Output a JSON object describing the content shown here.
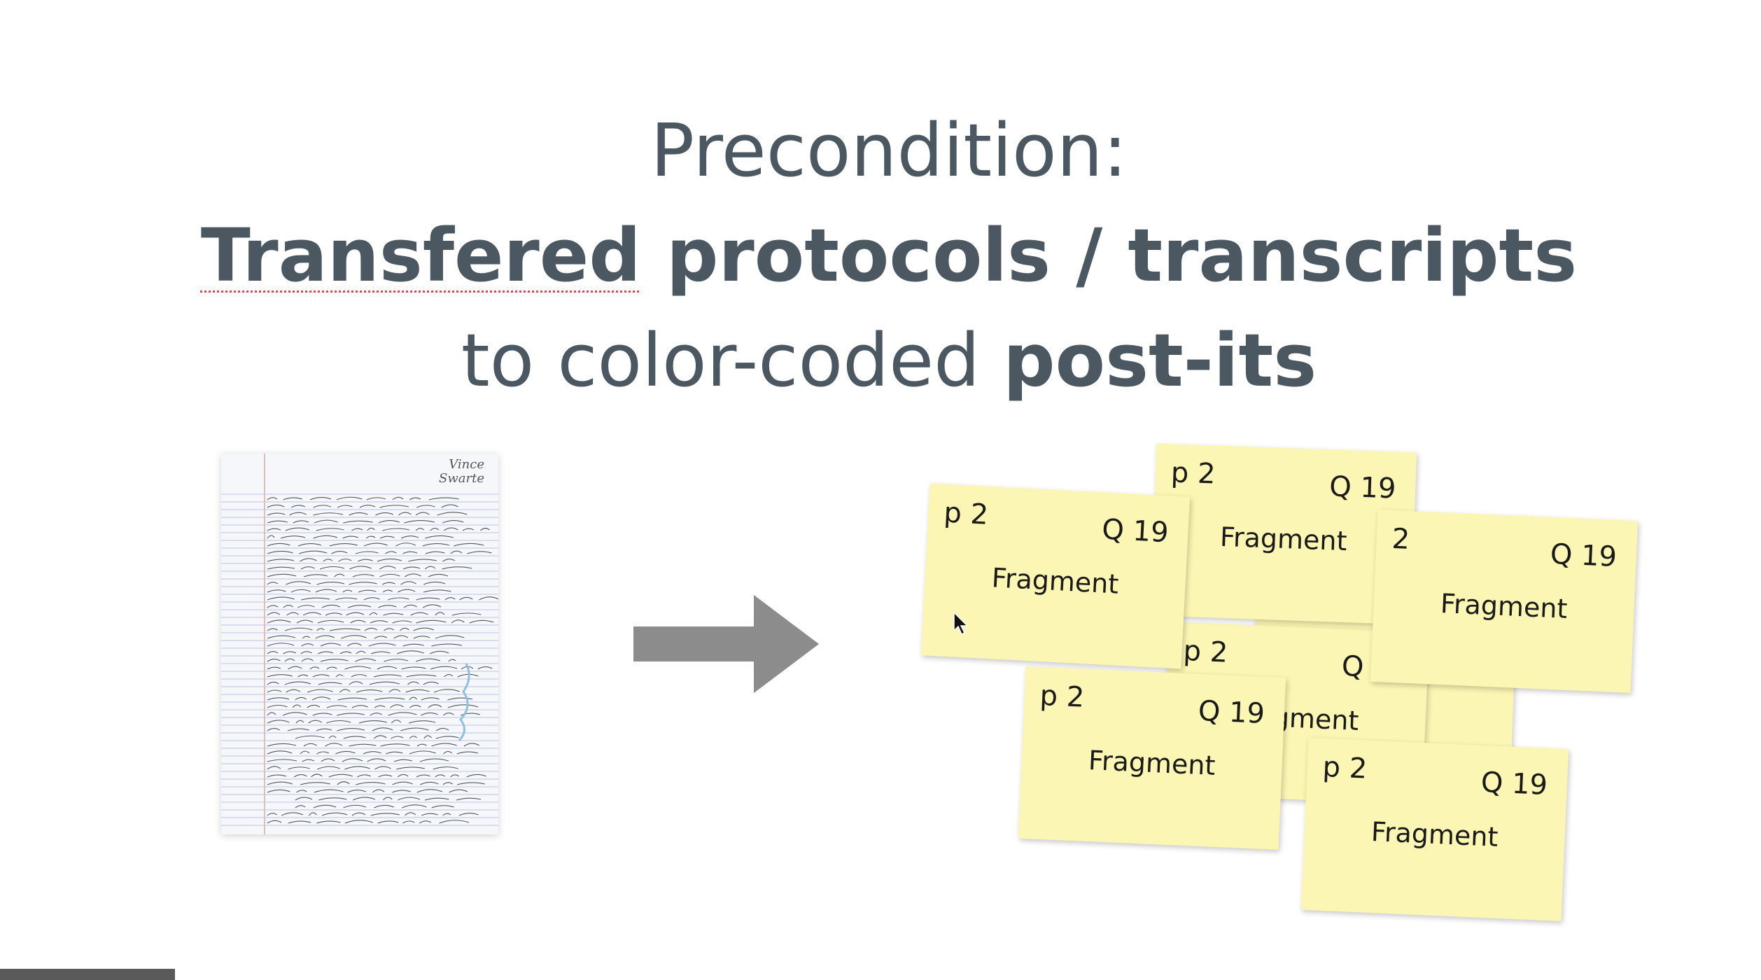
{
  "slide": {
    "title_line1": "Precondition:",
    "title_line2_part1": "Transfered",
    "title_line2_part2": " protocols / transcripts",
    "title_line3_part1": "to color-coded ",
    "title_line3_part2": "post-its"
  },
  "notebook": {
    "author_line1": "Vince",
    "author_line2": "Swarte"
  },
  "notes": [
    {
      "page": "p 2",
      "question": "Q 19",
      "label": "Fragment"
    },
    {
      "page": "p 2",
      "question": "Q 19",
      "label": "Fragment"
    },
    {
      "page": "2",
      "question": "Q 19",
      "label": "Fragment"
    },
    {
      "page": "p 2",
      "question": "Q 19",
      "label": "Fragment"
    },
    {
      "page": "",
      "question": "",
      "label": "gment"
    },
    {
      "page": "p 2",
      "question": "Q 19",
      "label": "Fragment"
    },
    {
      "page": "p 2",
      "question": "Q 19",
      "label": "Fragment"
    }
  ],
  "colors": {
    "text": "#4b5861",
    "note": "#fbf6b3",
    "arrow": "#8c8c8c",
    "progress": "#5a5a5a"
  },
  "icons": {
    "arrow": "right-arrow-icon",
    "cursor": "mouse-pointer-icon"
  }
}
